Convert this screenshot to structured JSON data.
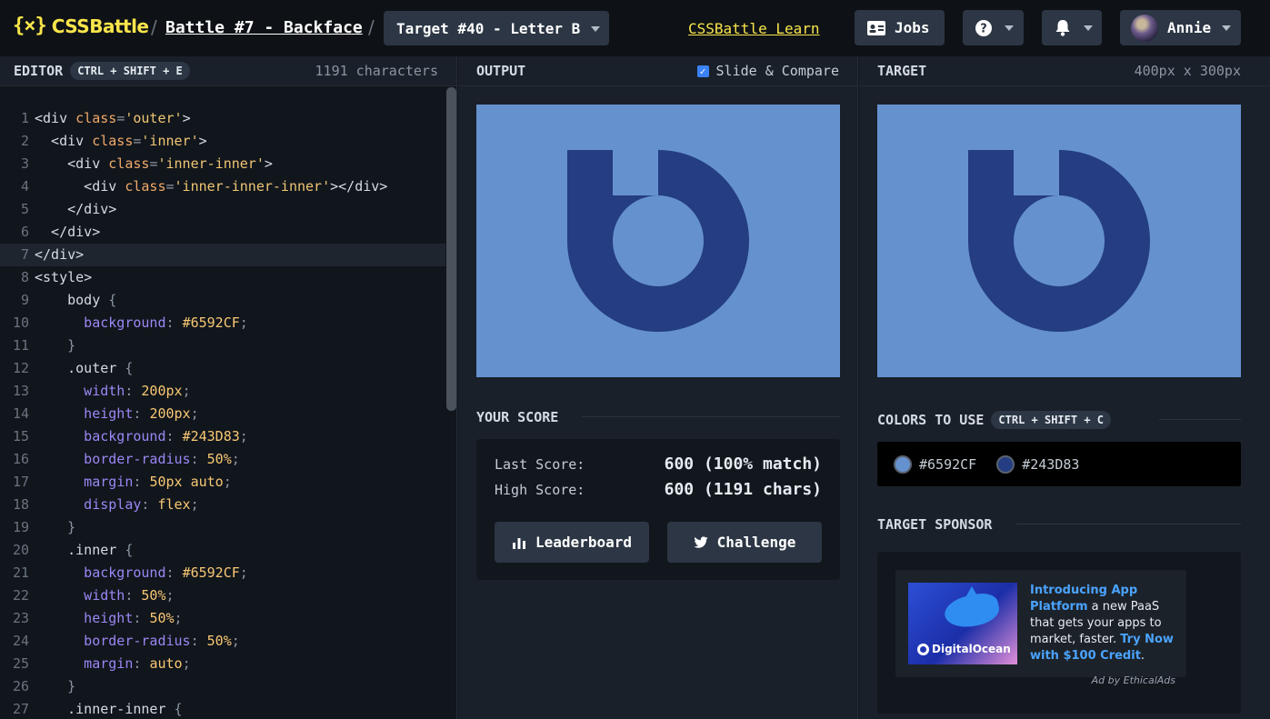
{
  "header": {
    "logo_mark": "{⨯}",
    "logo_text": "CSSBattle",
    "battle": "Battle #7 - Backface",
    "target": "Target #40 - Letter B",
    "learn": "CSSBattle Learn",
    "jobs": "Jobs",
    "help": "?",
    "user": "Annie"
  },
  "editor": {
    "title": "EDITOR",
    "shortcut": "CTRL + SHIFT + E",
    "char_count": "1191 characters",
    "lines": [
      {
        "n": "1",
        "t": [
          [
            "tag",
            "<div "
          ],
          [
            "attr",
            "class"
          ],
          [
            "pun",
            "="
          ],
          [
            "str",
            "'outer'"
          ],
          [
            "tag",
            ">"
          ]
        ]
      },
      {
        "n": "2",
        "t": [
          [
            "tag",
            "  <div "
          ],
          [
            "attr",
            "class"
          ],
          [
            "pun",
            "="
          ],
          [
            "str",
            "'inner'"
          ],
          [
            "tag",
            ">"
          ]
        ]
      },
      {
        "n": "3",
        "t": [
          [
            "tag",
            "    <div "
          ],
          [
            "attr",
            "class"
          ],
          [
            "pun",
            "="
          ],
          [
            "str",
            "'inner-inner'"
          ],
          [
            "tag",
            ">"
          ]
        ]
      },
      {
        "n": "4",
        "t": [
          [
            "tag",
            "      <div "
          ],
          [
            "attr",
            "class"
          ],
          [
            "pun",
            "="
          ],
          [
            "str",
            "'inner-inner-inner'"
          ],
          [
            "tag",
            "></div>"
          ]
        ]
      },
      {
        "n": "5",
        "t": [
          [
            "tag",
            "    </div>"
          ]
        ]
      },
      {
        "n": "6",
        "t": [
          [
            "tag",
            "  </div>"
          ]
        ]
      },
      {
        "n": "7",
        "t": [
          [
            "tag",
            "</div>"
          ]
        ],
        "active": true
      },
      {
        "n": "8",
        "t": [
          [
            "tag",
            "<style>"
          ]
        ]
      },
      {
        "n": "9",
        "t": [
          [
            "tag",
            "    body "
          ],
          [
            "pun",
            "{"
          ]
        ]
      },
      {
        "n": "10",
        "t": [
          [
            "prop",
            "      background"
          ],
          [
            "pun",
            ": "
          ],
          [
            "val",
            "#6592CF"
          ],
          [
            "pun",
            ";"
          ]
        ]
      },
      {
        "n": "11",
        "t": [
          [
            "pun",
            "    }"
          ]
        ]
      },
      {
        "n": "12",
        "t": [
          [
            "tag",
            "    .outer "
          ],
          [
            "pun",
            "{"
          ]
        ]
      },
      {
        "n": "13",
        "t": [
          [
            "prop",
            "      width"
          ],
          [
            "pun",
            ": "
          ],
          [
            "val",
            "200px"
          ],
          [
            "pun",
            ";"
          ]
        ]
      },
      {
        "n": "14",
        "t": [
          [
            "prop",
            "      height"
          ],
          [
            "pun",
            ": "
          ],
          [
            "val",
            "200px"
          ],
          [
            "pun",
            ";"
          ]
        ]
      },
      {
        "n": "15",
        "t": [
          [
            "prop",
            "      background"
          ],
          [
            "pun",
            ": "
          ],
          [
            "val",
            "#243D83"
          ],
          [
            "pun",
            ";"
          ]
        ]
      },
      {
        "n": "16",
        "t": [
          [
            "prop",
            "      border-radius"
          ],
          [
            "pun",
            ": "
          ],
          [
            "val",
            "50%"
          ],
          [
            "pun",
            ";"
          ]
        ]
      },
      {
        "n": "17",
        "t": [
          [
            "prop",
            "      margin"
          ],
          [
            "pun",
            ": "
          ],
          [
            "val",
            "50px auto"
          ],
          [
            "pun",
            ";"
          ]
        ]
      },
      {
        "n": "18",
        "t": [
          [
            "prop",
            "      display"
          ],
          [
            "pun",
            ": "
          ],
          [
            "val",
            "flex"
          ],
          [
            "pun",
            ";"
          ]
        ]
      },
      {
        "n": "19",
        "t": [
          [
            "pun",
            "    }"
          ]
        ]
      },
      {
        "n": "20",
        "t": [
          [
            "tag",
            "    .inner "
          ],
          [
            "pun",
            "{"
          ]
        ]
      },
      {
        "n": "21",
        "t": [
          [
            "prop",
            "      background"
          ],
          [
            "pun",
            ": "
          ],
          [
            "val",
            "#6592CF"
          ],
          [
            "pun",
            ";"
          ]
        ]
      },
      {
        "n": "22",
        "t": [
          [
            "prop",
            "      width"
          ],
          [
            "pun",
            ": "
          ],
          [
            "val",
            "50%"
          ],
          [
            "pun",
            ";"
          ]
        ]
      },
      {
        "n": "23",
        "t": [
          [
            "prop",
            "      height"
          ],
          [
            "pun",
            ": "
          ],
          [
            "val",
            "50%"
          ],
          [
            "pun",
            ";"
          ]
        ]
      },
      {
        "n": "24",
        "t": [
          [
            "prop",
            "      border-radius"
          ],
          [
            "pun",
            ": "
          ],
          [
            "val",
            "50%"
          ],
          [
            "pun",
            ";"
          ]
        ]
      },
      {
        "n": "25",
        "t": [
          [
            "prop",
            "      margin"
          ],
          [
            "pun",
            ": "
          ],
          [
            "val",
            "auto"
          ],
          [
            "pun",
            ";"
          ]
        ]
      },
      {
        "n": "26",
        "t": [
          [
            "pun",
            "    }"
          ]
        ]
      },
      {
        "n": "27",
        "t": [
          [
            "tag",
            "    .inner-inner "
          ],
          [
            "pun",
            "{"
          ]
        ]
      }
    ]
  },
  "output": {
    "title": "OUTPUT",
    "slide_label": "Slide & Compare",
    "slide_checked": "✓"
  },
  "score": {
    "title": "YOUR SCORE",
    "last_label": "Last Score:",
    "last_value": "600 (100% match)",
    "high_label": "High Score:",
    "high_value": "600 (1191 chars)",
    "leaderboard": "Leaderboard",
    "challenge": "Challenge"
  },
  "target": {
    "title": "TARGET",
    "size": "400px x 300px",
    "colors_title": "COLORS TO USE",
    "colors_shortcut": "CTRL + SHIFT + C",
    "colors": [
      {
        "hex": "#6592CF"
      },
      {
        "hex": "#243D83"
      }
    ],
    "sponsor_title": "TARGET SPONSOR"
  },
  "ad": {
    "brand": "DigitalOcean",
    "headline": "Introducing App Platform",
    "body": " a new PaaS that gets your apps to market, faster. ",
    "cta": "Try Now with $100 Credit",
    "period": ".",
    "by": "Ad by EthicalAds"
  },
  "colors": {
    "bg": "#6592CF",
    "shape": "#243D83",
    "accent": "#F9E54B"
  }
}
